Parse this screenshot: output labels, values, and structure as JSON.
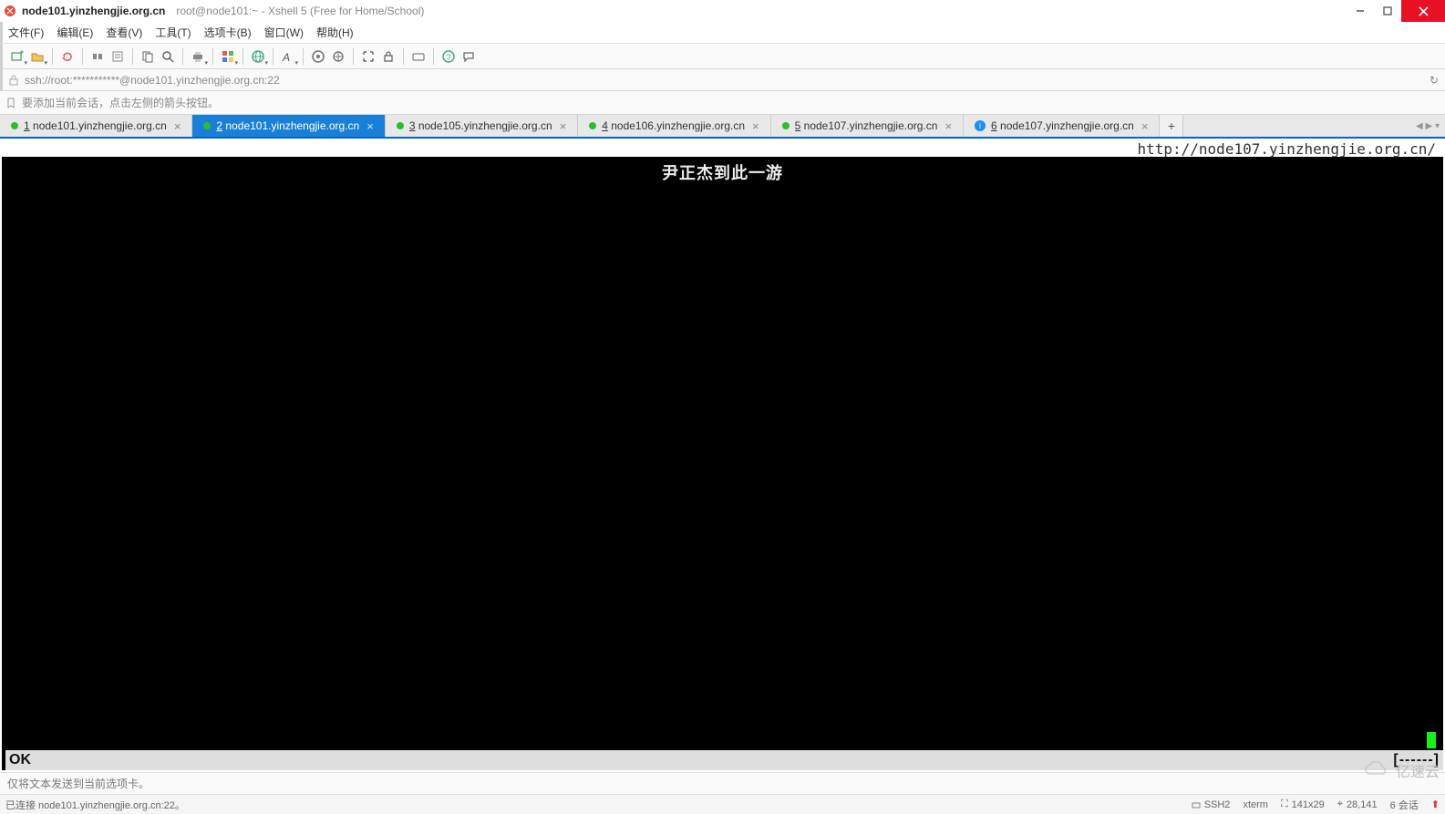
{
  "titlebar": {
    "host": "node101.yinzhengjie.org.cn",
    "subtitle": "root@node101:~ - Xshell 5 (Free for Home/School)"
  },
  "menu": {
    "file": "文件(F)",
    "edit": "编辑(E)",
    "view": "查看(V)",
    "tools": "工具(T)",
    "tab": "选项卡(B)",
    "window": "窗口(W)",
    "help": "帮助(H)"
  },
  "address": "ssh://root:***********@node101.yinzhengjie.org.cn:22",
  "hint": "要添加当前会话，点击左侧的箭头按钮。",
  "tabs": [
    {
      "n": "1",
      "label": "node101.yinzhengjie.org.cn",
      "status": "green",
      "active": false
    },
    {
      "n": "2",
      "label": "node101.yinzhengjie.org.cn",
      "status": "green",
      "active": true
    },
    {
      "n": "3",
      "label": "node105.yinzhengjie.org.cn",
      "status": "green",
      "active": false
    },
    {
      "n": "4",
      "label": "node106.yinzhengjie.org.cn",
      "status": "green",
      "active": false
    },
    {
      "n": "5",
      "label": "node107.yinzhengjie.org.cn",
      "status": "green",
      "active": false
    },
    {
      "n": "6",
      "label": "node107.yinzhengjie.org.cn",
      "status": "info",
      "active": false
    }
  ],
  "terminal": {
    "header_url": "http://node107.yinzhengjie.org.cn/",
    "content_line": "尹正杰到此一游",
    "ok_text": "OK",
    "position_text": "[------]"
  },
  "infobar": "仅将文本发送到当前选项卡。",
  "status": {
    "left": "已连接 node101.yinzhengjie.org.cn:22。",
    "ssh": "SSH2",
    "term": "xterm",
    "size": "141x29",
    "pos": "28,141",
    "sessions": "6 会话"
  },
  "watermark": "亿速云"
}
